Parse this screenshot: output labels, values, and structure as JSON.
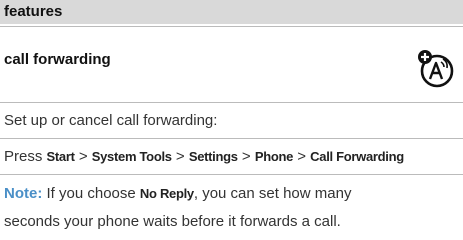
{
  "header": {
    "section": "features"
  },
  "feature": {
    "title": "call forwarding",
    "icon": "network-feature-icon"
  },
  "description": "Set up or cancel call forwarding:",
  "path": {
    "prefix": "Press",
    "separator": ">",
    "items": [
      "Start",
      "System Tools",
      "Settings",
      "Phone",
      "Call Forwarding"
    ]
  },
  "note": {
    "label": "Note:",
    "text_before": "If you choose",
    "highlight": "No Reply",
    "text_after": ", you can set how many",
    "line2": "seconds your phone waits before it forwards a call."
  },
  "colors": {
    "header_bg": "#d9d9d9",
    "note_label": "#4a8fc7",
    "divider": "#bbbbbb"
  }
}
